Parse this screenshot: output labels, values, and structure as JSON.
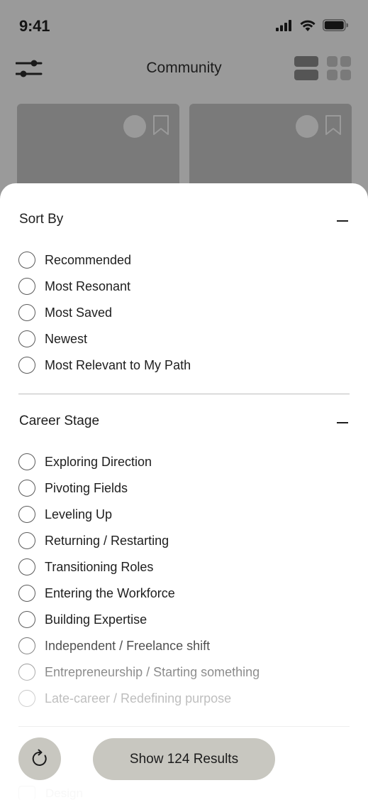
{
  "status_bar": {
    "time": "9:41"
  },
  "header": {
    "title": "Community"
  },
  "sort_by": {
    "title": "Sort By",
    "options": [
      "Recommended",
      "Most Resonant",
      "Most Saved",
      "Newest",
      "Most Relevant to My Path"
    ]
  },
  "career_stage": {
    "title": "Career Stage",
    "options": [
      "Exploring Direction",
      "Pivoting Fields",
      "Leveling Up",
      "Returning / Restarting",
      "Transitioning Roles",
      "Entering the Workforce",
      "Building Expertise",
      "Independent / Freelance shift",
      "Entrepreneurship / Starting something",
      "Late-career / Redefining purpose"
    ]
  },
  "footer": {
    "results_label": "Show 124 Results",
    "partial_next_option": "Design"
  }
}
